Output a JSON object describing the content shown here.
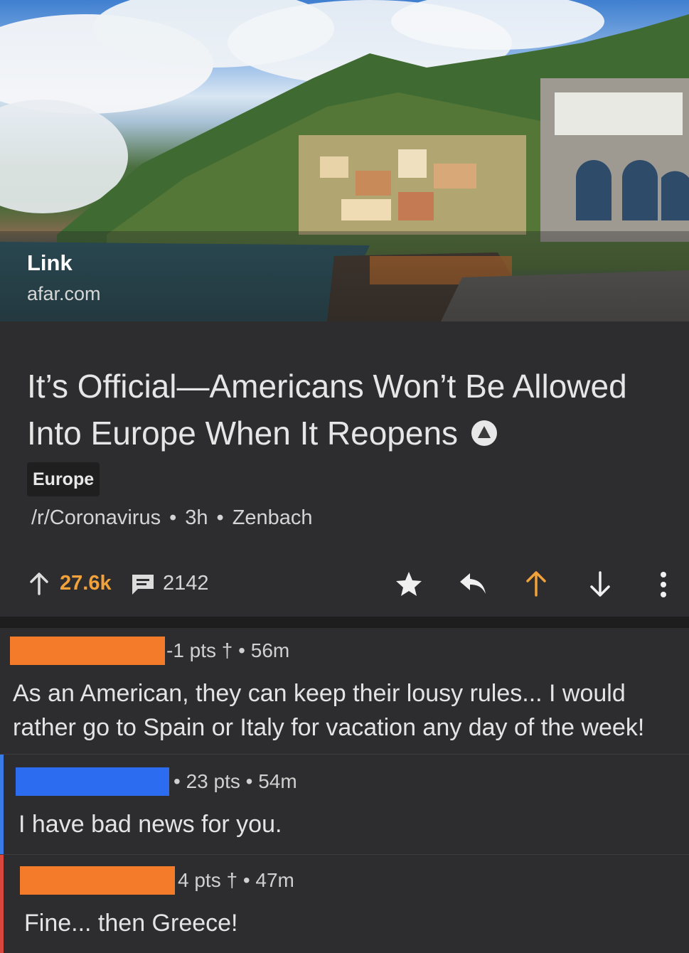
{
  "link_card": {
    "label": "Link",
    "domain": "afar.com"
  },
  "post": {
    "title": "It’s Official—Americans Won’t Be Allowed Into Europe When It Reopens",
    "flair": "Europe",
    "subreddit": "/r/Coronavirus",
    "age": "3h",
    "author": "Zenbach",
    "score": "27.6k",
    "comment_count": "2142"
  },
  "comments": [
    {
      "meta": "-1 pts † • 56m",
      "text": "As an American, they can keep their lousy rules... I would rather go to Spain or Italy for vacation any day of the week!",
      "redact_color": "#f47b2a"
    },
    {
      "meta": "• 23 pts • 54m",
      "text": "I have bad news for you.",
      "redact_color": "#2c6cf0",
      "depth_color": "#3b7be8"
    },
    {
      "meta": "4 pts † • 47m",
      "text": "Fine... then Greece!",
      "redact_color": "#f47b2a",
      "depth_color": "#d9473c"
    }
  ],
  "colors": {
    "background": "#2d2d2f",
    "score_orange": "#f2a23a",
    "upvote_orange": "#f2a23a"
  },
  "icons": [
    "upvote-arrow-icon",
    "comments-icon",
    "star-icon",
    "reply-icon",
    "upvote-icon",
    "downvote-icon",
    "more-options-icon",
    "flair-triangle-icon"
  ]
}
